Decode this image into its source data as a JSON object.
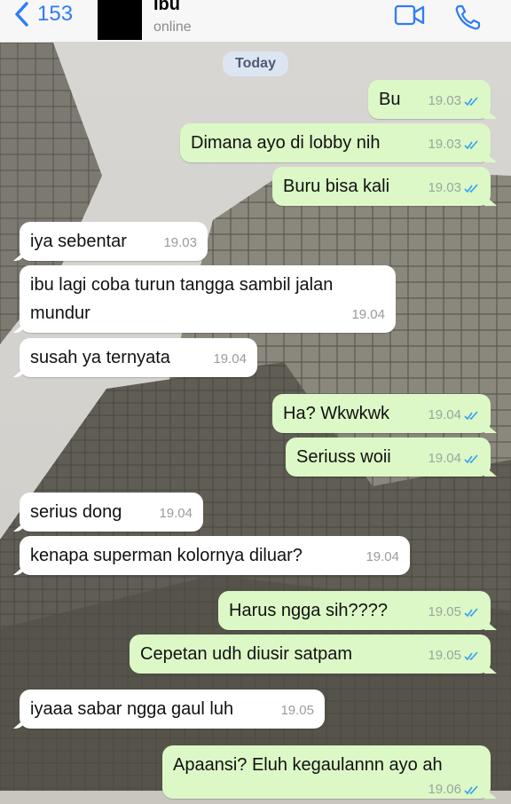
{
  "header": {
    "back_count": "153",
    "contact_name": "Ibu",
    "status": "online"
  },
  "day_label": "Today",
  "messages": [
    {
      "dir": "out",
      "text": "Bu",
      "time": "19.03",
      "read": true
    },
    {
      "dir": "out",
      "text": "Dimana ayo di lobby nih",
      "time": "19.03",
      "read": true
    },
    {
      "dir": "out",
      "text": "Buru bisa kali",
      "time": "19.03",
      "read": true
    },
    {
      "dir": "in",
      "text": "iya sebentar",
      "time": "19.03"
    },
    {
      "dir": "in",
      "text": "ibu lagi coba turun tangga sambil jalan mundur",
      "time": "19.04"
    },
    {
      "dir": "in",
      "text": "susah ya ternyata",
      "time": "19.04"
    },
    {
      "dir": "out",
      "text": "Ha? Wkwkwk",
      "time": "19.04",
      "read": true
    },
    {
      "dir": "out",
      "text": "Seriuss woii",
      "time": "19.04",
      "read": true
    },
    {
      "dir": "in",
      "text": "serius dong",
      "time": "19.04"
    },
    {
      "dir": "in",
      "text": "kenapa superman kolornya diluar?",
      "time": "19.04"
    },
    {
      "dir": "out",
      "text": "Harus ngga sih????",
      "time": "19.05",
      "read": true
    },
    {
      "dir": "out",
      "text": "Cepetan udh diusir satpam",
      "time": "19.05",
      "read": true
    },
    {
      "dir": "in",
      "text": "iyaaa sabar ngga gaul luh",
      "time": "19.05"
    },
    {
      "dir": "out",
      "text": "Apaansi? Eluh kegaulannn ayo ah",
      "time": "19.06",
      "read": true
    }
  ],
  "colors": {
    "accent": "#2f7cf6",
    "outgoing_bubble": "#dcf8c6",
    "incoming_bubble": "#ffffff",
    "read_tick": "#34a0f5"
  },
  "icons": {
    "back": "chevron-left-icon",
    "video": "video-camera-icon",
    "phone": "phone-icon",
    "read": "double-check-icon"
  }
}
